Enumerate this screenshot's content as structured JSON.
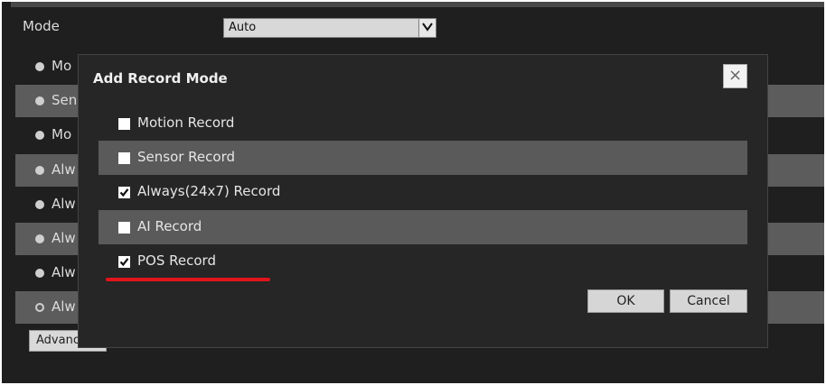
{
  "mode": {
    "label": "Mode",
    "selected": "Auto"
  },
  "background_rows": [
    {
      "text": "Mo",
      "radio": "filled",
      "alt": false
    },
    {
      "text": "Sen",
      "radio": "filled",
      "alt": true
    },
    {
      "text": "Mo",
      "radio": "filled",
      "alt": false
    },
    {
      "text": "Alw",
      "radio": "filled",
      "alt": true
    },
    {
      "text": "Alw",
      "radio": "filled",
      "alt": false
    },
    {
      "text": "Alw",
      "radio": "filled",
      "alt": true
    },
    {
      "text": "Alw",
      "radio": "filled",
      "alt": false
    },
    {
      "text": "Alw",
      "radio": "hollow",
      "alt": true
    }
  ],
  "advanced_button": "Advanc",
  "modal": {
    "title": "Add Record Mode",
    "close_symbol": "×",
    "options": [
      {
        "label": "Motion Record",
        "checked": false
      },
      {
        "label": "Sensor Record",
        "checked": false
      },
      {
        "label": "Always(24x7) Record",
        "checked": true
      },
      {
        "label": "AI Record",
        "checked": false
      },
      {
        "label": "POS Record",
        "checked": true
      }
    ],
    "ok_label": "OK",
    "cancel_label": "Cancel"
  },
  "colors": {
    "highlight_underline": "#e0141b"
  }
}
